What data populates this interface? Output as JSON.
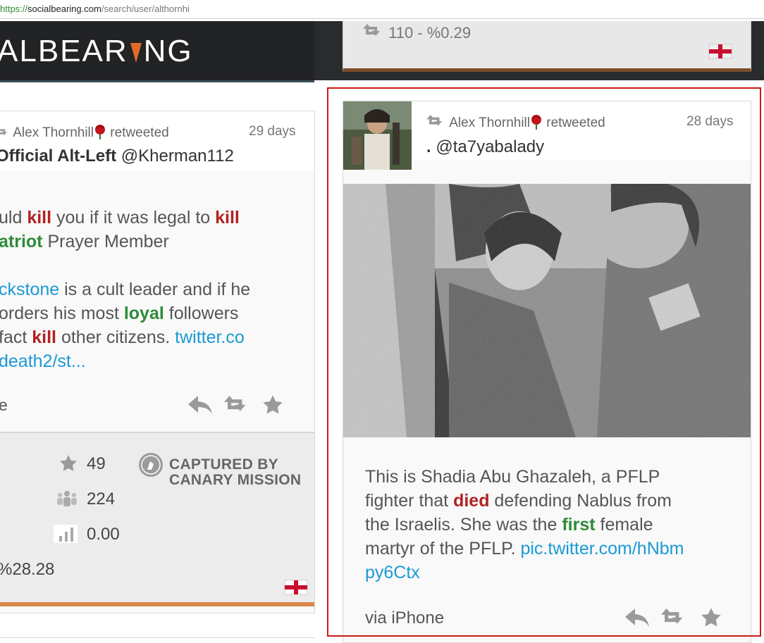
{
  "browser": {
    "url_scheme": "https://",
    "url_host": "socialbearing.com",
    "url_path": "/search/user/althornhi"
  },
  "logo": {
    "text_left": "ALBEAR",
    "text_right": "NG"
  },
  "top_card": {
    "retweet_stat": "110 - %0.29"
  },
  "left_card": {
    "retweeter": "Alex Thornhill",
    "retweeted_label": "retweeted",
    "age": "29 days",
    "author_name": "Official Alt-Left",
    "author_handle": "@Kherman112",
    "text": {
      "l1a": "uld ",
      "l1b": "kill",
      "l1c": " you if it was legal to ",
      "l1d": "kill",
      "l2a": "atriot",
      "l2b": " Prayer Member",
      "l3a": "ckstone",
      "l3b": " is a cult leader and if he",
      "l4a": " orders his most ",
      "l4b": "loyal",
      "l4c": " followers",
      "l5a": " fact ",
      "l5b": "kill",
      "l5c": " other citizens. ",
      "l5d": "twitter.co",
      "l6": "death2/st..."
    },
    "via_fragment": "e",
    "stats": {
      "favorites": "49",
      "followers": "224",
      "ratio": "0.00",
      "percent": "%28.28"
    },
    "captured_line1": "CAPTURED BY",
    "captured_line2": "CANARY MISSION"
  },
  "right_card": {
    "retweeter": "Alex Thornhill",
    "retweeted_label": "retweeted",
    "age": "28 days",
    "author_name": ".",
    "author_handle": "@ta7yabalady",
    "text": {
      "l1": "This is Shadia Abu Ghazaleh, a PFLP",
      "l2a": "fighter that ",
      "l2b": "died",
      "l2c": " defending Nablus from",
      "l3a": "the Israelis. She was the ",
      "l3b": "first",
      "l3c": " female",
      "l4a": "martyr of the PFLP. ",
      "l4b": "pic.twitter.com/hNbm",
      "l5": "py6Ctx"
    },
    "via": "via iPhone"
  },
  "colors": {
    "selection_border": "#cc1a1a",
    "link": "#1a9ad6",
    "keyword_red": "#b22222",
    "keyword_green": "#2e8b3a",
    "accent_orange": "#d9874a"
  },
  "icons": [
    "retweet-icon",
    "rose-icon",
    "reply-icon",
    "star-icon",
    "people-icon",
    "bars-icon",
    "flag-icon",
    "bird-badge-icon"
  ]
}
